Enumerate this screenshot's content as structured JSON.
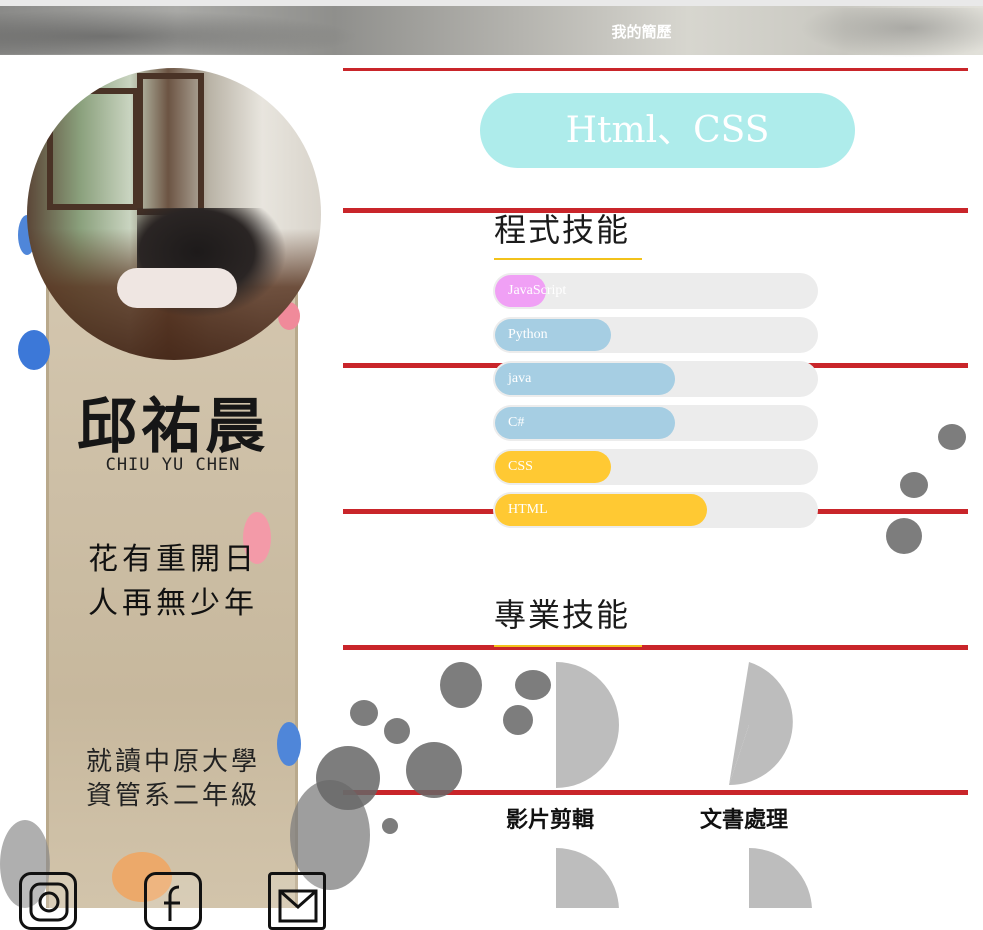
{
  "header": {
    "title": "我的簡歷"
  },
  "profile": {
    "name": "邱祐晨",
    "english_name": "CHIU YU CHEN",
    "poem": [
      "花有重開日",
      "人再無少年"
    ],
    "school": [
      "就讀中原大學",
      "資管系二年級"
    ]
  },
  "social": [
    {
      "name": "instagram-icon"
    },
    {
      "name": "facebook-icon"
    },
    {
      "name": "mail-icon"
    }
  ],
  "featured_skill": "Html、CSS",
  "programming": {
    "title": "程式技能",
    "skills": [
      {
        "label": "JavaScript",
        "level": 0.16,
        "color": "#f0a0f5"
      },
      {
        "label": "Python",
        "level": 0.36,
        "color": "#a6cee3"
      },
      {
        "label": "java",
        "level": 0.56,
        "color": "#a6cee3"
      },
      {
        "label": "C#",
        "level": 0.56,
        "color": "#a6cee3"
      },
      {
        "label": "CSS",
        "level": 0.36,
        "color": "#ffc933"
      },
      {
        "label": "HTML",
        "level": 0.66,
        "color": "#ffc933"
      }
    ]
  },
  "professional": {
    "title": "專業技能",
    "skills": [
      {
        "label": "影片剪輯",
        "level": 0.5
      },
      {
        "label": "文書處理",
        "level": 0.55
      }
    ]
  },
  "colors": {
    "accent_red": "#c9252a",
    "pill_bg": "#aeeceb",
    "underline": "#f2c21b",
    "pie": "#bdbdbd"
  }
}
